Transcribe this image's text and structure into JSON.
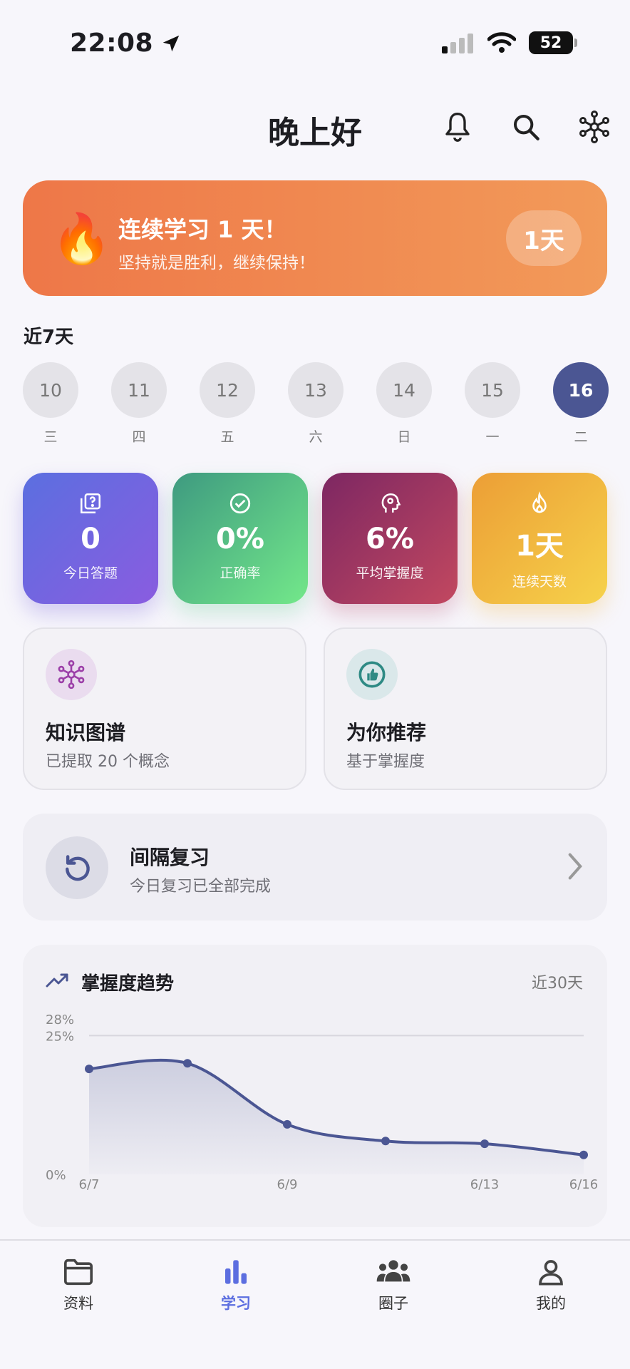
{
  "status": {
    "time": "22:08",
    "battery": "52"
  },
  "header": {
    "title": "晚上好"
  },
  "banner": {
    "title": "连续学习 1 天！",
    "subtitle": "坚持就是胜利，继续保持！",
    "pill": "1天"
  },
  "week": {
    "title": "近7天",
    "days": [
      {
        "date": "10",
        "weekday": "三"
      },
      {
        "date": "11",
        "weekday": "四"
      },
      {
        "date": "12",
        "weekday": "五"
      },
      {
        "date": "13",
        "weekday": "六"
      },
      {
        "date": "14",
        "weekday": "日"
      },
      {
        "date": "15",
        "weekday": "一"
      },
      {
        "date": "16",
        "weekday": "二"
      }
    ]
  },
  "stats": [
    {
      "value": "0",
      "label": "今日答题"
    },
    {
      "value": "0%",
      "label": "正确率"
    },
    {
      "value": "6%",
      "label": "平均掌握度"
    },
    {
      "value": "1天",
      "label": "连续天数"
    }
  ],
  "features": [
    {
      "title": "知识图谱",
      "subtitle": "已提取 20 个概念"
    },
    {
      "title": "为你推荐",
      "subtitle": "基于掌握度"
    }
  ],
  "review": {
    "title": "间隔复习",
    "subtitle": "今日复习已全部完成"
  },
  "trend": {
    "title": "掌握度趋势",
    "range": "近30天"
  },
  "chart_data": {
    "type": "area",
    "x": [
      "6/7",
      "6/8",
      "6/9",
      "6/11",
      "6/13",
      "6/16"
    ],
    "x_tick_labels": [
      "6/7",
      "6/9",
      "6/13",
      "6/16"
    ],
    "values": [
      19,
      20,
      9,
      6,
      5.5,
      3.5
    ],
    "y_tick_labels": [
      "28%",
      "25%",
      "0%"
    ],
    "ylim": [
      0,
      28
    ],
    "grid": "25% line",
    "line_color": "#4b5693"
  },
  "tabs": [
    {
      "label": "资料"
    },
    {
      "label": "学习"
    },
    {
      "label": "圈子"
    },
    {
      "label": "我的"
    }
  ]
}
